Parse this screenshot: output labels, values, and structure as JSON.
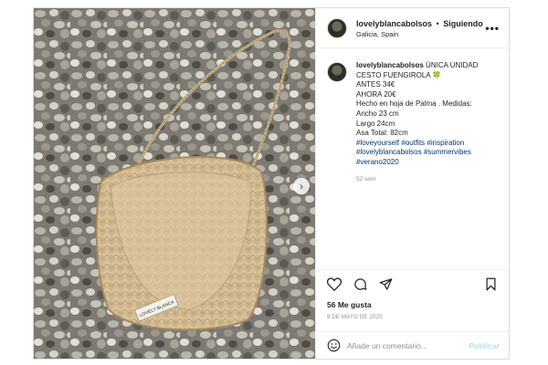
{
  "post": {
    "username": "lovelyblancabolsos",
    "separator": "•",
    "follow_label": "Siguiendo",
    "location": "Galicia, Spain",
    "more_label": "•••",
    "caption_lines": [
      "ÚNICA UNIDAD",
      "CESTO FUENGIROLA 🍀",
      "ANTES 34€",
      "AHORA 20€",
      "Hecho en hoja de Palma . Medidas:",
      "Ancho 23 cm",
      "Largo 24cm",
      "Asa Total: 82cm"
    ],
    "hashtags": [
      [
        "#loveyourself",
        "#outfits",
        "#inspiration"
      ],
      [
        "#lovelyblancabolsos",
        "#summervibes"
      ],
      [
        "#verano2020"
      ]
    ],
    "time_ago": "52 sem",
    "likes": "56 Me gusta",
    "date": "8 DE MAYO DE 2020",
    "comment_placeholder": "Añade un comentario...",
    "publish_label": "Publicar",
    "bag_label": "LOVELY BLANCA"
  },
  "icons": {
    "heart": "heart-icon",
    "comment": "comment-icon",
    "share": "share-icon",
    "save": "bookmark-icon",
    "emoji": "emoji-icon",
    "next": "chevron-right-icon"
  },
  "colors": {
    "hashtag": "#00376b",
    "publish": "#b2dffc",
    "muted": "#8e8e8e"
  }
}
